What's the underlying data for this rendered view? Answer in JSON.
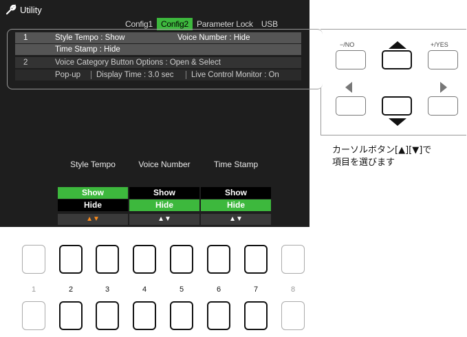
{
  "screen": {
    "title": "Utility",
    "tabs": [
      "Config1",
      "Config2",
      "Parameter Lock",
      "USB"
    ],
    "active_tab": "Config2",
    "rows": {
      "r1_num": "1",
      "r1_label": "Style Tempo : Show",
      "r1_right": "Voice Number : Hide",
      "r1b_label": "Time Stamp : Hide",
      "r2_num": "2",
      "r2_label": "Voice Category Button Options : Open & Select",
      "r3_a": "Pop-up",
      "r3_b": "Display Time : 3.0 sec",
      "r3_c": "Live Control Monitor : On"
    },
    "columns": [
      {
        "header": "Style Tempo",
        "options": [
          "Show",
          "Hide"
        ],
        "selected": "Show",
        "arrows": "▲▼"
      },
      {
        "header": "Voice Number",
        "options": [
          "Show",
          "Hide"
        ],
        "selected": "Hide",
        "arrows": "▲▼"
      },
      {
        "header": "Time Stamp",
        "options": [
          "Show",
          "Hide"
        ],
        "selected": "Hide",
        "arrows": "▲▼"
      }
    ]
  },
  "panel_buttons": {
    "minus_label": "−/NO",
    "plus_label": "+/YES"
  },
  "caption": {
    "line1": "カーソルボタン[▲][▼]で",
    "line2": "項目を選びます"
  },
  "slots": [
    "1",
    "2",
    "3",
    "4",
    "5",
    "6",
    "7",
    "8"
  ],
  "colors": {
    "accent": "#3db83d",
    "arrow_active": "#ff8c1a",
    "screen_bg": "#1e1e1e"
  }
}
